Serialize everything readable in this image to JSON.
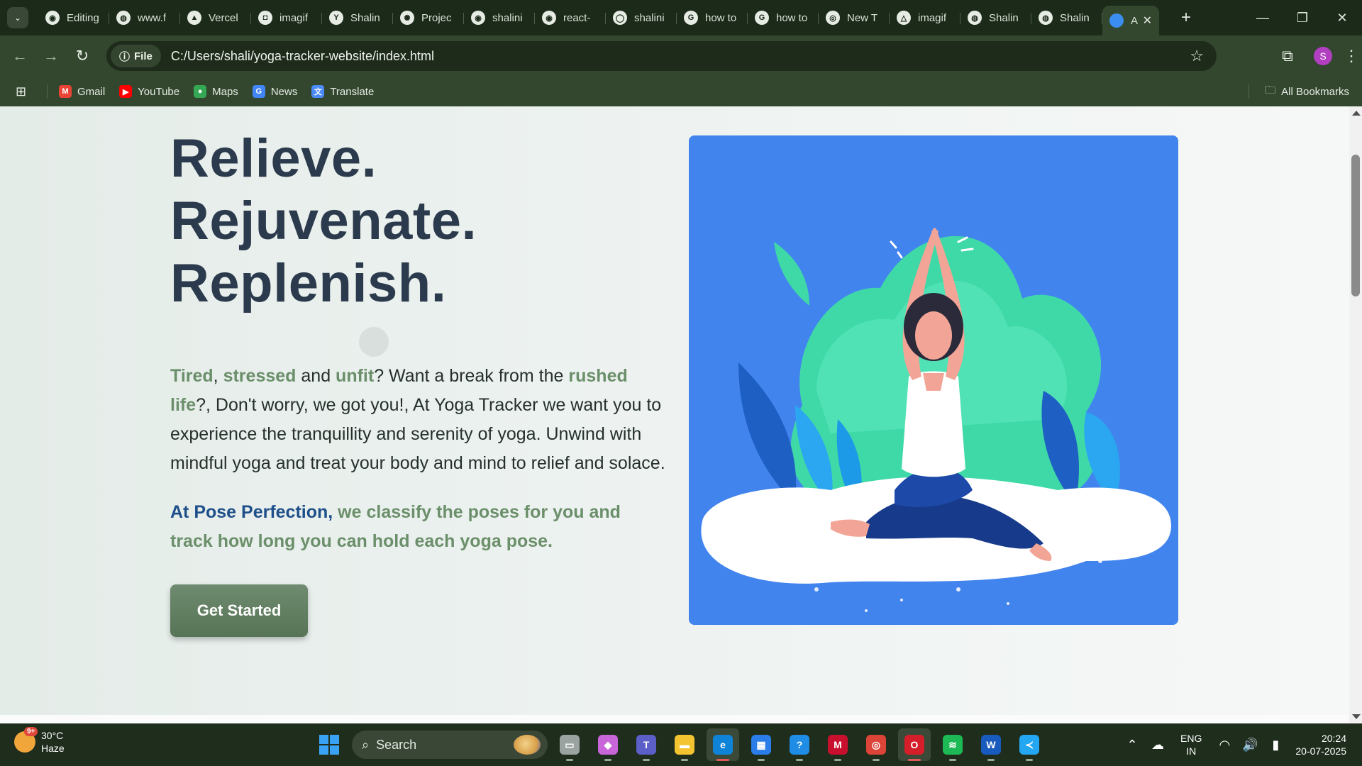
{
  "browser": {
    "tabs": [
      {
        "title": "Editing",
        "icon": "github-icon",
        "fav": "◉"
      },
      {
        "title": "www.f",
        "icon": "globe-icon",
        "fav": "◍"
      },
      {
        "title": "Vercel",
        "icon": "vercel-icon",
        "fav": "▲"
      },
      {
        "title": "imagif",
        "icon": "imagify-icon",
        "fav": "◘"
      },
      {
        "title": "Shalin",
        "icon": "y-combinator-icon",
        "fav": "Y"
      },
      {
        "title": "Projec",
        "icon": "openai-icon",
        "fav": "✺"
      },
      {
        "title": "shalini",
        "icon": "github-icon",
        "fav": "◉"
      },
      {
        "title": "react-",
        "icon": "github-icon",
        "fav": "◉"
      },
      {
        "title": "shalini",
        "icon": "github-dim-icon",
        "fav": "◯"
      },
      {
        "title": "how to",
        "icon": "google-icon",
        "fav": "G"
      },
      {
        "title": "how to",
        "icon": "google-icon",
        "fav": "G"
      },
      {
        "title": "New T",
        "icon": "chrome-icon",
        "fav": "◎"
      },
      {
        "title": "imagif",
        "icon": "drive-icon",
        "fav": "△"
      },
      {
        "title": "Shalin",
        "icon": "globe-icon",
        "fav": "◍"
      },
      {
        "title": "Shalin",
        "icon": "globe-icon",
        "fav": "◍"
      }
    ],
    "active_tab": {
      "title": "A",
      "close": "✕"
    },
    "new_tab": "+",
    "window_controls": {
      "minimize": "—",
      "maximize": "❐",
      "close": "✕"
    },
    "nav": {
      "back": "←",
      "forward": "→",
      "reload": "↻"
    },
    "site_chip": "File",
    "site_chip_icon": "ⓘ",
    "url": "C:/Users/shali/yoga-tracker-website/index.html",
    "bookmark_star": "☆",
    "extensions_icon": "⧉",
    "profile_initial": "S",
    "menu_icon": "⋮",
    "bookmarks": [
      {
        "label": "Gmail",
        "icon": "gmail-icon",
        "glyph": "M",
        "color": "#ea4335"
      },
      {
        "label": "YouTube",
        "icon": "youtube-icon",
        "glyph": "▶",
        "color": "#ff0000"
      },
      {
        "label": "Maps",
        "icon": "maps-icon",
        "glyph": "●",
        "color": "#34a853"
      },
      {
        "label": "News",
        "icon": "news-icon",
        "glyph": "G",
        "color": "#4285f4"
      },
      {
        "label": "Translate",
        "icon": "translate-icon",
        "glyph": "文",
        "color": "#4a8af4"
      }
    ],
    "apps_icon": "⊞",
    "all_bookmarks": "All Bookmarks",
    "folder_icon": "🗀"
  },
  "page": {
    "headline": {
      "line1": "Relieve.",
      "line2": "Rejuvenate.",
      "line3": "Replenish."
    },
    "intro": {
      "w1": "Tired",
      "sep1": ", ",
      "w2": "stressed",
      "sep2": " and ",
      "w3": "unfit",
      "sep3": "? Want a break from the ",
      "w4": "rushed life",
      "rest": "?, Don't worry, we got you!, At Yoga Tracker we want you to experience the tranquillity and serenity of yoga. Unwind with mindful yoga and treat your body and mind to relief and solace."
    },
    "tagline": {
      "brand": "At Pose Perfection,",
      "text": " we classify the poses for you and track how long you can hold each yoga pose."
    },
    "cta": "Get Started",
    "colors": {
      "heading": "#2b3a4c",
      "accent": "#52e3a5",
      "highlight": "#6b8f6a",
      "brand": "#1e4f8a",
      "illustration_bg": "#4284ee",
      "button": "#6f8b70"
    }
  },
  "taskbar": {
    "weather": {
      "temp": "30°C",
      "condition": "Haze",
      "badge": "9+"
    },
    "search_label": "Search",
    "search_icon": "⌕",
    "apps": [
      {
        "name": "task-view",
        "glyph": "▭",
        "color": "#9aa3a0"
      },
      {
        "name": "copilot",
        "glyph": "◆",
        "color": "#c865d8"
      },
      {
        "name": "teams",
        "glyph": "T",
        "color": "#5b5fc7"
      },
      {
        "name": "file-explorer",
        "glyph": "▬",
        "color": "#f4c430"
      },
      {
        "name": "edge",
        "glyph": "e",
        "color": "#0f83d8"
      },
      {
        "name": "microsoft-store",
        "glyph": "▦",
        "color": "#2b7de9"
      },
      {
        "name": "get-help",
        "glyph": "?",
        "color": "#1f8de6"
      },
      {
        "name": "mcafee",
        "glyph": "M",
        "color": "#c8102e"
      },
      {
        "name": "chrome",
        "glyph": "◎",
        "color": "#db4437"
      },
      {
        "name": "opera",
        "glyph": "O",
        "color": "#d41e2a"
      },
      {
        "name": "spotify",
        "glyph": "≋",
        "color": "#1db954"
      },
      {
        "name": "word",
        "glyph": "W",
        "color": "#185abd"
      },
      {
        "name": "vscode",
        "glyph": "≺",
        "color": "#23a7f2"
      }
    ],
    "tray": {
      "chevron": "⌃",
      "onedrive": "☁",
      "lang1": "ENG",
      "lang2": "IN",
      "wifi": "◠",
      "volume": "🔊",
      "battery": "▮",
      "time": "20:24",
      "date": "20-07-2025"
    }
  }
}
